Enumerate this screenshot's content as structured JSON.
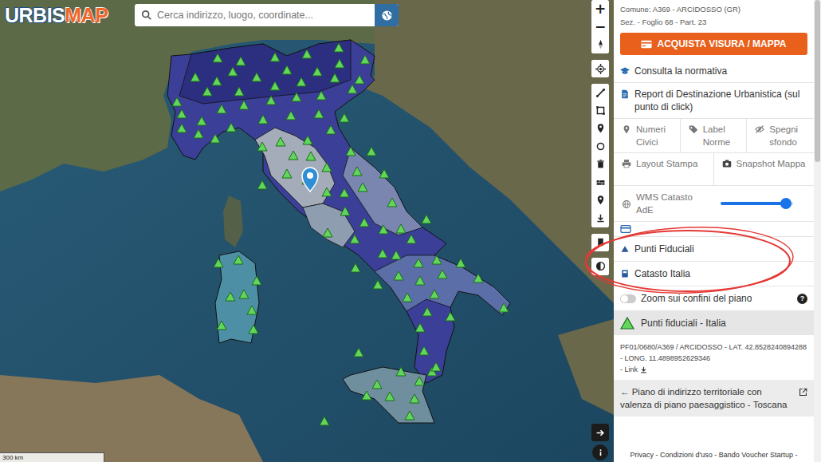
{
  "logo": {
    "first": "URBIS",
    "second": "MAP"
  },
  "search": {
    "placeholder": "Cerca indirizzo, luogo, coordinate..."
  },
  "zoom": [
    "+",
    "−"
  ],
  "scale": "300 km",
  "parcel": {
    "comune": "Comune: A369 - ARCIDOSSO (GR)",
    "ref": "Sez. - Foglio 68 - Part. 23"
  },
  "buy_button": "ACQUISTA VISURA / MAPPA",
  "links": [
    "Consulta la normativa",
    "Report di Destinazione Urbanistica (sul punto di click)"
  ],
  "tools": [
    {
      "label": "Numeri Civici"
    },
    {
      "label": "Label Norme"
    },
    {
      "label": "Spegni sfondo"
    }
  ],
  "tools2": [
    {
      "label": "Layout Stampa"
    },
    {
      "label": "Snapshot Mappa"
    }
  ],
  "wms": {
    "label": "WMS Catasto AdE",
    "level": 0.9
  },
  "layers": [
    {
      "label": "Punti Fiduciali",
      "highlighted": true
    },
    {
      "label": "Catasto Italia",
      "highlighted": true
    }
  ],
  "zoom_toggle": {
    "label": "Zoom sui confini del piano",
    "on": false,
    "help": "?"
  },
  "result": {
    "title": "Punti fiduciali - Italia",
    "text": "PF01/0680/A369 / ARCIDOSSO - LAT. 42.8528240894288 - LONG. 11.4898952629346",
    "link": "- Link"
  },
  "plan": {
    "arrow": "←",
    "title": "Piano di indirizzo territoriale con valenza di piano paesaggistico - Toscana"
  },
  "footer": "Privacy - Condizioni d'uso - Bando Voucher Startup -",
  "scrollbar": {
    "level": 0.35
  }
}
